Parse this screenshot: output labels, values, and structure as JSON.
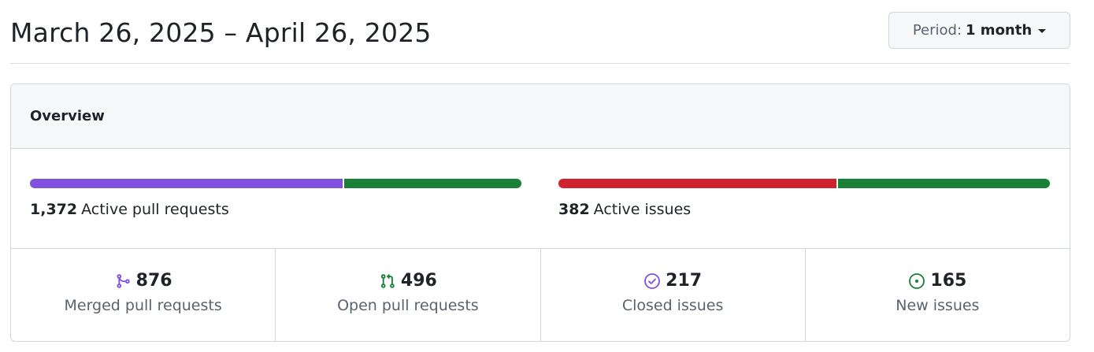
{
  "header": {
    "date_range": "March 26, 2025 – April 26, 2025",
    "period_label": "Period:",
    "period_value": "1 month"
  },
  "overview": {
    "title": "Overview",
    "pull_requests": {
      "count": "1,372",
      "label": "Active pull requests",
      "bar": [
        {
          "name": "merged",
          "value": 876,
          "color": "#8250df"
        },
        {
          "name": "open",
          "value": 496,
          "color": "#1a7f37"
        }
      ]
    },
    "issues": {
      "count": "382",
      "label": "Active issues",
      "bar": [
        {
          "name": "closed",
          "value": 217,
          "color": "#cf222e"
        },
        {
          "name": "new",
          "value": 165,
          "color": "#1a7f37"
        }
      ]
    }
  },
  "stats": [
    {
      "value": "876",
      "label": "Merged pull requests",
      "icon": "git-merge-icon",
      "color": "#8250df"
    },
    {
      "value": "496",
      "label": "Open pull requests",
      "icon": "git-pull-request-icon",
      "color": "#1a7f37"
    },
    {
      "value": "217",
      "label": "Closed issues",
      "icon": "issue-closed-icon",
      "color": "#8250df"
    },
    {
      "value": "165",
      "label": "New issues",
      "icon": "issue-opened-icon",
      "color": "#1a7f37"
    }
  ]
}
